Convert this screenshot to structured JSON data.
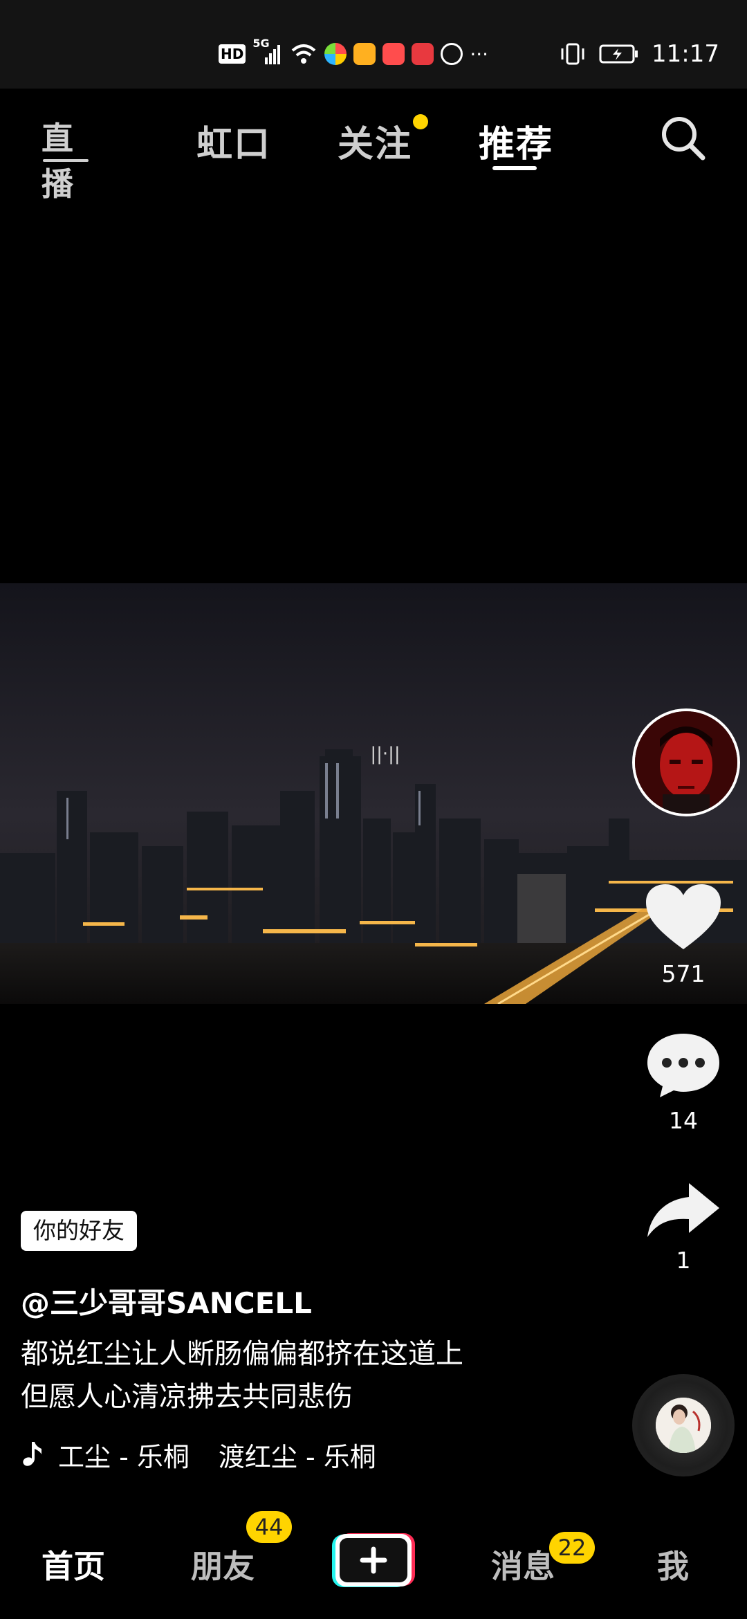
{
  "status_bar": {
    "time": "11:17",
    "network": "5G",
    "hd": "HD",
    "more": "···"
  },
  "top_nav": {
    "live_label": "直播",
    "tabs": [
      {
        "label": "虹口",
        "active": false
      },
      {
        "label": "关注",
        "active": false,
        "has_dot": true
      },
      {
        "label": "推荐",
        "active": true
      }
    ]
  },
  "video": {
    "center_mark": "||·||"
  },
  "actions": {
    "likes": "571",
    "comments": "14",
    "shares": "1"
  },
  "post": {
    "friend_badge": "你的好友",
    "author": "@三少哥哥SANCELL",
    "description_lines": [
      "都说红尘让人断肠偏偏都挤在这道上",
      "但愿人心清凉拂去共同悲伤"
    ],
    "music": {
      "song1": "工尘 - 乐桐",
      "song2": "渡红尘 - 乐桐"
    }
  },
  "bottom_nav": {
    "items": [
      {
        "label": "首页",
        "active": true
      },
      {
        "label": "朋友",
        "badge": "44"
      },
      {
        "label": "消息",
        "badge": "22"
      },
      {
        "label": "我"
      }
    ]
  },
  "colors": {
    "accent_yellow": "#ffd400",
    "create_cyan": "#25f4ee",
    "create_red": "#fe2c55"
  }
}
